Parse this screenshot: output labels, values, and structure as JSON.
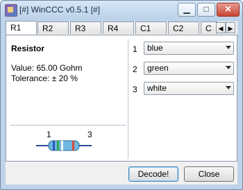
{
  "window": {
    "title": "[#] WinCCC v0.5.1 [#]",
    "min_icon": "minimize-icon",
    "max_icon": "maximize-icon",
    "close_icon": "close-icon",
    "min_glyph": "▁",
    "max_glyph": "□",
    "close_glyph": "✕"
  },
  "tabs": [
    "R1",
    "R2",
    "R3",
    "R4",
    "C1",
    "C2",
    "C"
  ],
  "tab_scroll": {
    "left_glyph": "◀",
    "right_glyph": "▶"
  },
  "panel": {
    "heading": "Resistor",
    "value_text": "Value: 65.00 Gohm",
    "tolerance_text": "Tolerance: ± 20 %",
    "pin_left": "1",
    "pin_right": "3"
  },
  "bands": [
    {
      "number": "1",
      "selected": "blue"
    },
    {
      "number": "2",
      "selected": "green"
    },
    {
      "number": "3",
      "selected": "white"
    }
  ],
  "band_colors": {
    "blue": "#2d56c2",
    "green": "#2ea84a",
    "white": "#f7f7f7",
    "body": "#6fb8e0",
    "tolerance": "#d94b3f"
  },
  "buttons": {
    "decode": "Decode!",
    "close": "Close"
  }
}
